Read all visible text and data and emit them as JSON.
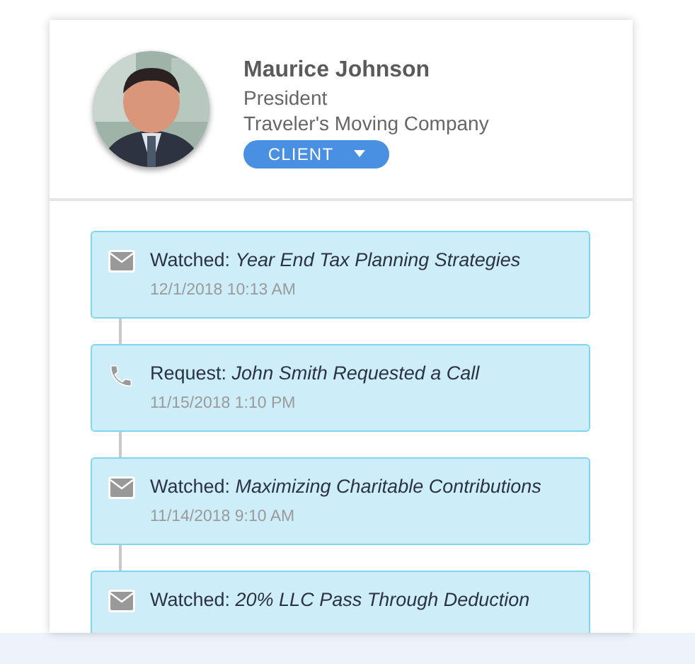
{
  "profile": {
    "name": "Maurice Johnson",
    "title": "President",
    "company": "Traveler's Moving Company",
    "badge": "CLIENT"
  },
  "activity": [
    {
      "kind": "email",
      "text": "Watched: *Year End Tax Planning Strategies*",
      "time": "12/1/2018 10:13 AM"
    },
    {
      "kind": "phone",
      "text": "Request: *John Smith Requested  a Call*",
      "time": "11/15/2018 1:10 PM"
    },
    {
      "kind": "email",
      "text": "Watched: *Maximizing Charitable Contributions*",
      "time": "11/14/2018 9:10 AM"
    },
    {
      "kind": "email",
      "text": "Watched: *20% LLC Pass Through Deduction*"
    }
  ]
}
